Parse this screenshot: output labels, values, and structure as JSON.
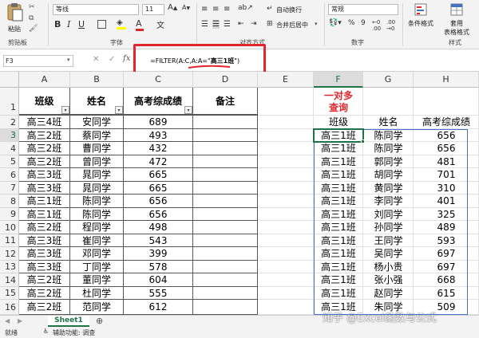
{
  "ribbon": {
    "paste_label": "粘贴",
    "clipboard_label": "剪贴板",
    "font_name": "等线",
    "font_size": "11",
    "font_group_label": "字体",
    "align_group_label": "对齐方式",
    "wrap_text_label": "自动换行",
    "merge_center_label": "合并后居中",
    "number_format": "常规",
    "number_group_label": "数字",
    "cond_format_label": "条件格式",
    "table_format_label": "套用",
    "table_format_label2": "表格格式",
    "styles_label": "样式"
  },
  "formula_bar": {
    "name_box": "F3",
    "formula_prefix": "=FILTER(A:C,A:A=\"",
    "formula_highlight": "高三1班",
    "formula_suffix": "\")",
    "fx_label": "fx"
  },
  "columns": [
    "A",
    "B",
    "C",
    "D",
    "E",
    "F",
    "G",
    "H"
  ],
  "row_numbers": [
    "1",
    "2",
    "3",
    "4",
    "5",
    "6",
    "7",
    "8",
    "9",
    "10",
    "11",
    "12",
    "13",
    "14",
    "15",
    "16"
  ],
  "headers": {
    "a": "班级",
    "b": "姓名",
    "c": "高考综成绩",
    "d": "备注",
    "f_line1": "一对多",
    "f_line2": "查询",
    "f2": "班级",
    "g2": "姓名",
    "h2": "高考综成绩"
  },
  "source_rows": [
    {
      "a": "高三4班",
      "b": "安同学",
      "c": "689"
    },
    {
      "a": "高三2班",
      "b": "蔡同学",
      "c": "493"
    },
    {
      "a": "高三2班",
      "b": "曹同学",
      "c": "432"
    },
    {
      "a": "高三2班",
      "b": "曾同学",
      "c": "472"
    },
    {
      "a": "高三3班",
      "b": "晁同学",
      "c": "665"
    },
    {
      "a": "高三3班",
      "b": "晁同学",
      "c": "665"
    },
    {
      "a": "高三1班",
      "b": "陈同学",
      "c": "656"
    },
    {
      "a": "高三1班",
      "b": "陈同学",
      "c": "656"
    },
    {
      "a": "高三2班",
      "b": "程同学",
      "c": "498"
    },
    {
      "a": "高三3班",
      "b": "崔同学",
      "c": "543"
    },
    {
      "a": "高三3班",
      "b": "邓同学",
      "c": "399"
    },
    {
      "a": "高三3班",
      "b": "丁同学",
      "c": "578"
    },
    {
      "a": "高三2班",
      "b": "董同学",
      "c": "604"
    },
    {
      "a": "高三2班",
      "b": "杜同学",
      "c": "555"
    },
    {
      "a": "高三2班",
      "b": "范同学",
      "c": "612"
    }
  ],
  "result_rows": [
    {
      "f": "高三1班",
      "g": "陈同学",
      "h": "656"
    },
    {
      "f": "高三1班",
      "g": "陈同学",
      "h": "656"
    },
    {
      "f": "高三1班",
      "g": "郭同学",
      "h": "481"
    },
    {
      "f": "高三1班",
      "g": "胡同学",
      "h": "701"
    },
    {
      "f": "高三1班",
      "g": "黄同学",
      "h": "310"
    },
    {
      "f": "高三1班",
      "g": "李同学",
      "h": "401"
    },
    {
      "f": "高三1班",
      "g": "刘同学",
      "h": "325"
    },
    {
      "f": "高三1班",
      "g": "孙同学",
      "h": "489"
    },
    {
      "f": "高三1班",
      "g": "王同学",
      "h": "593"
    },
    {
      "f": "高三1班",
      "g": "吴同学",
      "h": "697"
    },
    {
      "f": "高三1班",
      "g": "杨小贵",
      "h": "697"
    },
    {
      "f": "高三1班",
      "g": "张小强",
      "h": "668"
    },
    {
      "f": "高三1班",
      "g": "赵同学",
      "h": "615"
    },
    {
      "f": "高三1班",
      "g": "朱同学",
      "h": "509"
    }
  ],
  "sheet_tab": "Sheet1",
  "status": {
    "ready": "就绪",
    "accessibility": "辅助功能: 调查"
  },
  "watermark": "知乎 @Excel函数与公式",
  "colors": {
    "accent_green": "#217346",
    "highlight_red": "#e3252d",
    "result_border": "#4472c4"
  }
}
